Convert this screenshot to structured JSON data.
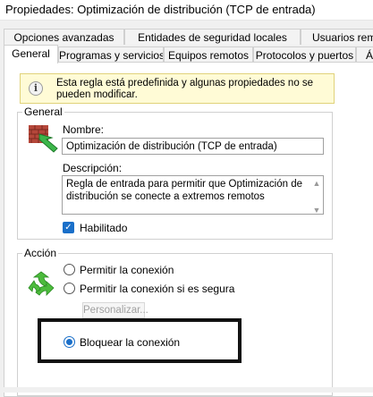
{
  "window": {
    "title": "Propiedades: Optimización de distribución (TCP de entrada)"
  },
  "tabs": {
    "row_back": [
      {
        "label": "Opciones avanzadas"
      },
      {
        "label": "Entidades de seguridad locales"
      },
      {
        "label": "Usuarios remot"
      }
    ],
    "row_front": [
      {
        "label": "General",
        "selected": true
      },
      {
        "label": "Programas y servicios"
      },
      {
        "label": "Equipos remotos"
      },
      {
        "label": "Protocolos y puertos"
      },
      {
        "label": "Á"
      }
    ]
  },
  "info": {
    "icon": "info-icon",
    "text": "Esta regla está predefinida y algunas propiedades no se pueden modificar."
  },
  "general": {
    "group_label": "General",
    "icon": "firewall-icon",
    "name_label": "Nombre:",
    "name_value": "Optimización de distribución (TCP de entrada)",
    "description_label": "Descripción:",
    "description_value": "Regla de entrada para permitir que Optimización de distribución se conecte a extremos remotos",
    "enabled_label": "Habilitado",
    "enabled": true
  },
  "action": {
    "group_label": "Acción",
    "icon": "action-arrows-icon",
    "options": [
      {
        "label": "Permitir la conexión",
        "selected": false
      },
      {
        "label": "Permitir la conexión si es segura",
        "selected": false
      },
      {
        "label": "Bloquear la conexión",
        "selected": true
      }
    ],
    "customize_label": "Personalizar..."
  },
  "colors": {
    "accent": "#1a6fc9",
    "info_background": "#fffbd6",
    "highlight_border": "#111111"
  }
}
